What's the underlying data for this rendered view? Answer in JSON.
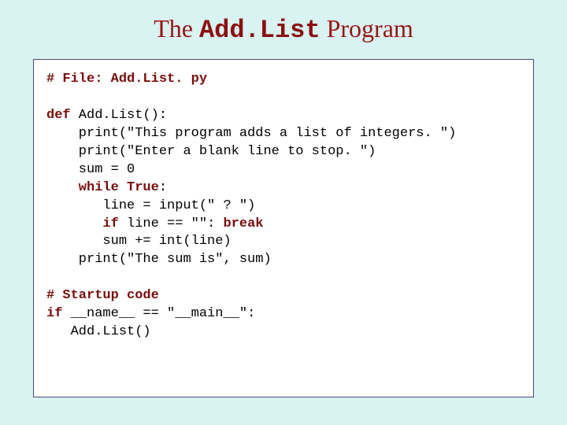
{
  "title": {
    "pre": "The ",
    "mono": "Add.List",
    "post": " Program"
  },
  "code": {
    "c1": "# File: Add.List. py",
    "kw_def": "def",
    "fn_name": " Add.List():",
    "l_print1a": "    print(",
    "l_print1b": "\"This program adds a list of integers. \"",
    "l_print1c": ")",
    "l_print2a": "    print(",
    "l_print2b": "\"Enter a blank line to stop. \"",
    "l_print2c": ")",
    "l_sum": "    sum = 0",
    "kw_while": "    while True",
    "colon1": ":",
    "l_input_a": "       line = input(",
    "l_input_b": "\" ? \"",
    "l_input_c": ")",
    "kw_if": "       if",
    "l_if_mid": " line == ",
    "l_if_str": "\"\"",
    "l_if_colon": ": ",
    "kw_break": "break",
    "l_sumadd": "       sum += int(line)",
    "l_print3a": "    print(",
    "l_print3b": "\"The sum is\"",
    "l_print3c": ", sum)",
    "c2": "# Startup code",
    "kw_if2": "if",
    "l_main_a": " __name__ == ",
    "l_main_b": "\"__main__\"",
    "l_main_c": ":",
    "l_call": "   Add.List()"
  }
}
